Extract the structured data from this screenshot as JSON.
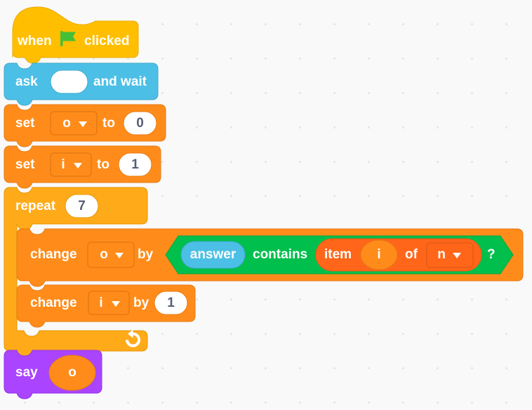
{
  "workspace": {
    "name": "scratch-block-workspace",
    "background_color": "#F9F9F9",
    "grid_dot_color": "#E6E6E6"
  },
  "palette": {
    "events_yellow": "#FFBF00",
    "sensing_blue": "#4CBFE6",
    "variables_orange": "#FF8C1A",
    "variables_orange_dark": "#E67A12",
    "control_yellow": "#FFAB19",
    "operators_green": "#00BF4C",
    "list_orange": "#FF6619",
    "list_orange_dark": "#E65C17",
    "looks_purple": "#AA44FF",
    "input_white": "#FFFFFF",
    "text_white": "#FFFFFF",
    "number_text": "#575E75",
    "flag_green": "#45BF36"
  },
  "script": {
    "name": "main-script",
    "blocks": [
      {
        "id": "when-flag-clicked",
        "type": "hat",
        "category": "events",
        "label_before": "when",
        "icon": "green-flag-icon",
        "label_after": "clicked"
      },
      {
        "id": "ask-and-wait",
        "type": "stack",
        "category": "sensing",
        "label_before": "ask",
        "input_value": "",
        "label_after": "and wait"
      },
      {
        "id": "set-o-to-0",
        "type": "stack",
        "category": "variables",
        "label_before": "set",
        "dropdown_value": "o",
        "label_middle": "to",
        "input_value": "0"
      },
      {
        "id": "set-i-to-1",
        "type": "stack",
        "category": "variables",
        "label_before": "set",
        "dropdown_value": "i",
        "label_middle": "to",
        "input_value": "1"
      },
      {
        "id": "repeat-7",
        "type": "c-block",
        "category": "control",
        "label_before": "repeat",
        "input_value": "7",
        "loop_icon": "loop-arrow-icon",
        "children": [
          {
            "id": "change-o-by-contains",
            "type": "stack",
            "category": "variables",
            "label_before": "change",
            "dropdown_value": "o",
            "label_middle": "by",
            "expression": {
              "id": "contains-boolean",
              "type": "boolean",
              "category": "operators",
              "left_operand": {
                "id": "answer-reporter",
                "category": "sensing",
                "label": "answer"
              },
              "label": "contains",
              "right_operand": {
                "id": "item-of-list",
                "category": "list",
                "label_before": "item",
                "index_value": "i",
                "label_middle": "of",
                "dropdown_value": "n"
              },
              "label_after": "?"
            }
          },
          {
            "id": "change-i-by-1",
            "type": "stack",
            "category": "variables",
            "label_before": "change",
            "dropdown_value": "i",
            "label_middle": "by",
            "input_value": "1"
          }
        ]
      },
      {
        "id": "say-o",
        "type": "stack",
        "category": "looks",
        "label_before": "say",
        "variable_value": "o"
      }
    ]
  },
  "labels": {
    "when": "when",
    "clicked": "clicked",
    "ask": "ask",
    "and_wait": "and wait",
    "ask_input": "",
    "set": "set",
    "to": "to",
    "var_o": "o",
    "var_i": "i",
    "var_n": "n",
    "zero": "0",
    "one": "1",
    "repeat": "repeat",
    "seven": "7",
    "change": "change",
    "by": "by",
    "answer": "answer",
    "contains": "contains",
    "item": "item",
    "of": "of",
    "question_mark": "?",
    "say": "say"
  }
}
